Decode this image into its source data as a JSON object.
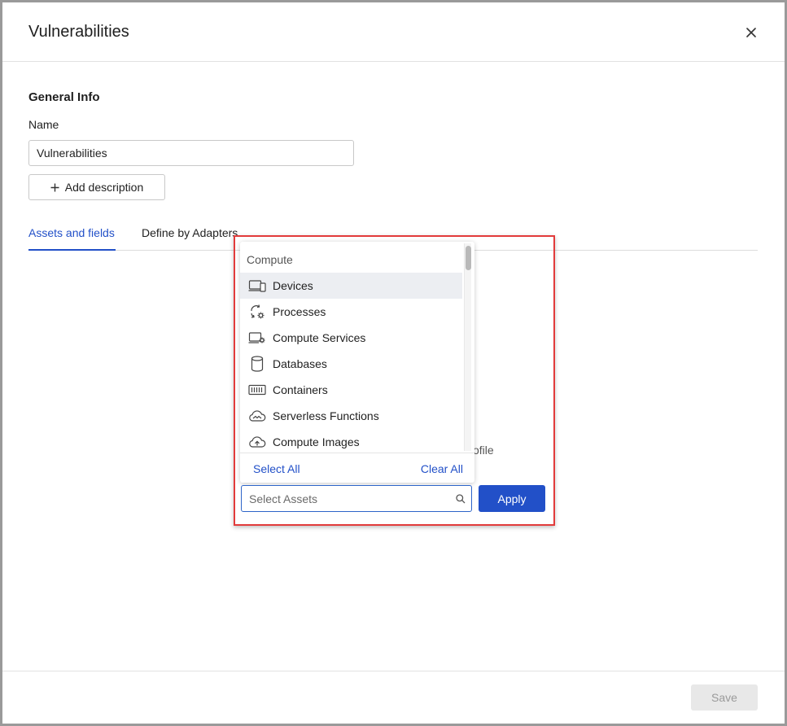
{
  "modal": {
    "title": "Vulnerabilities",
    "close_icon": "close-icon"
  },
  "general_info": {
    "heading": "General Info",
    "name_label": "Name",
    "name_value": "Vulnerabilities",
    "add_description_label": "Add description",
    "add_description_icon": "plus-icon"
  },
  "tabs": [
    {
      "label": "Assets and fields",
      "active": true
    },
    {
      "label": "Define by Adapters",
      "active": false
    }
  ],
  "background_partial_text": "ofile",
  "dropdown": {
    "group_label": "Compute",
    "items": [
      {
        "label": "Devices",
        "icon": "devices-icon",
        "selected": true
      },
      {
        "label": "Processes",
        "icon": "processes-icon",
        "selected": false
      },
      {
        "label": "Compute Services",
        "icon": "compute-services-icon",
        "selected": false
      },
      {
        "label": "Databases",
        "icon": "database-icon",
        "selected": false
      },
      {
        "label": "Containers",
        "icon": "containers-icon",
        "selected": false
      },
      {
        "label": "Serverless Functions",
        "icon": "serverless-icon",
        "selected": false
      },
      {
        "label": "Compute Images",
        "icon": "compute-images-icon",
        "selected": false
      }
    ],
    "select_all_label": "Select All",
    "clear_all_label": "Clear All"
  },
  "asset_search": {
    "placeholder": "Select Assets",
    "value": "",
    "icon": "search-icon"
  },
  "apply_label": "Apply",
  "save_label": "Save",
  "colors": {
    "accent": "#2250c8",
    "highlight_border": "#e23b3b",
    "selected_row": "#eceef2",
    "disabled_button": "#e8e8e8"
  }
}
